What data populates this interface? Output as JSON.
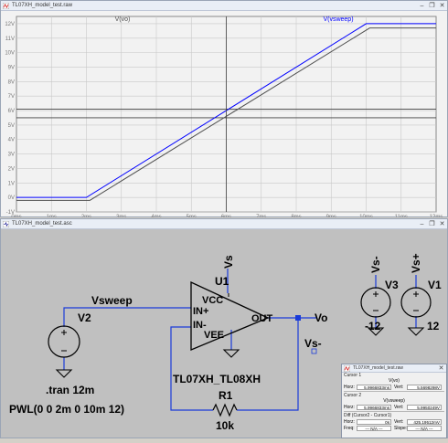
{
  "plot_window": {
    "title": "TL07XH_model_test.raw",
    "trace_vo": "V(vo)",
    "trace_vsweep": "V(vsweep)",
    "colors": {
      "vo": "#505050",
      "vsweep": "#0000ff",
      "background": "#f2f2f2",
      "grid": "#c8c8c8"
    }
  },
  "chart_data": {
    "type": "line",
    "x_unit": "ms",
    "y_unit": "V",
    "xlim": [
      0,
      12
    ],
    "ylim": [
      -1,
      12.5
    ],
    "x_ticks": [
      "0ms",
      "1ms",
      "2ms",
      "3ms",
      "4ms",
      "5ms",
      "6ms",
      "7ms",
      "8ms",
      "9ms",
      "10ms",
      "11ms",
      "12ms"
    ],
    "y_ticks": [
      "12V",
      "11V",
      "10V",
      "9V",
      "8V",
      "7V",
      "6V",
      "5V",
      "4V",
      "3V",
      "2V",
      "1V",
      "0V",
      "-1V"
    ],
    "grid": true,
    "series": [
      {
        "name": "V(vsweep)",
        "color": "#0000ff",
        "x": [
          0,
          2,
          10,
          12
        ],
        "y": [
          0,
          0,
          12,
          12
        ]
      },
      {
        "name": "V(vo)",
        "color": "#505050",
        "x": [
          0,
          2.1,
          10.1,
          12
        ],
        "y": [
          -0.2,
          -0.2,
          11.7,
          11.7
        ]
      }
    ],
    "cursor": {
      "x": 6,
      "y": 5.9
    },
    "reference_lines": [
      6.1,
      5.5
    ]
  },
  "schematic_window": {
    "title": "TL07XH_model_test.asc",
    "labels": {
      "vsweep": "Vsweep",
      "v2": "V2",
      "tran": ".tran 12m",
      "pwl": "PWL(0 0 2m 0 10m 12)",
      "u1": "U1",
      "vs": "Vs",
      "vcc": "VCC",
      "in_plus": "IN+",
      "in_minus": "IN-",
      "vee": "VEE",
      "out": "OUT",
      "vo": "Vo",
      "vs_minus": "Vs-",
      "model": "TL07XH_TL08XH",
      "r1": "R1",
      "r1_val": "10k",
      "v3_net": "Vs-",
      "v1_net": "Vs+",
      "v3": "V3",
      "v1": "V1",
      "v3_val": "-12",
      "v1_val": "12"
    }
  },
  "cursor_window": {
    "title": "TL07XH_model_test.raw",
    "cursor1_label": "Cursor 1",
    "cursor1_trace": "V(vo)",
    "horz_label": "Horz:",
    "vert_label": "Vert:",
    "c1_horz": "5.9966833ms",
    "c1_vert": "5.5698298V",
    "cursor2_label": "Cursor 2",
    "cursor2_trace": "V(vsweep)",
    "c2_horz": "5.9966833ms",
    "c2_vert": "5.9950249V",
    "diff_label": "Diff (Cursor2 - Cursor1)",
    "d_horz": "0s",
    "d_vert": "425.19512mV",
    "freq_label": "Freq:",
    "slope_label": "Slope:",
    "d_freq": "N/A",
    "d_slope": "N/A"
  }
}
